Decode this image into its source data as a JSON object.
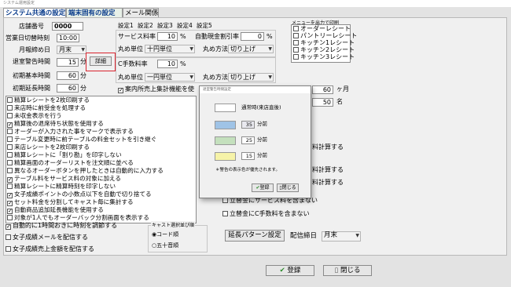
{
  "window": {
    "title": "システム運用設定"
  },
  "tabs": [
    {
      "label": "システム共通の設定",
      "active": true
    },
    {
      "label": "端末固有の設定",
      "active": false
    },
    {
      "label": "メール関係",
      "active": false
    }
  ],
  "left": {
    "store_no_label": "店舗番号",
    "store_no": "0000",
    "cutoff_label": "営業日切替時刻",
    "cutoff": "10:00",
    "closing_label": "月報締め日",
    "closing": "月末",
    "warn_label": "退室警告時間",
    "warn": "15",
    "warn_unit": "分",
    "detail_button": "詳細",
    "base_label": "初期基本時間",
    "base": "60",
    "base_unit": "分",
    "ext_label": "初期延長時間",
    "ext": "60",
    "ext_unit": "分"
  },
  "settings_tabs": [
    "設定1",
    "設定2",
    "設定3",
    "設定4",
    "設定5"
  ],
  "service": {
    "service_label": "サービス料率",
    "service_value": "10",
    "service_unit": "%",
    "auto_discount_label": "自動現金割引率",
    "auto_discount_value": "0",
    "auto_discount_unit": "%",
    "round_unit_label": "丸め単位",
    "round_unit_value": "十円単位",
    "round_method_label": "丸め方法",
    "round_method_value": "切り上げ",
    "c_fee_label": "C手数料率",
    "c_fee_value": "10",
    "c_fee_unit": "%",
    "round_unit2_label": "丸め単位",
    "round_unit2_value": "一円単位",
    "round_method2_label": "丸め方法",
    "round_method2_value": "切り上げ",
    "guide_checkbox": "案内所売上集計機能を使"
  },
  "print_menu": {
    "title": "メニューを出力で印刷",
    "items": [
      "オーダーレシート",
      "パントリーレシート",
      "キッチン1レシート",
      "キッチン2レシート",
      "キッチン3レシート"
    ]
  },
  "right_fields": {
    "months_value": "60",
    "months_unit": "ヶ月",
    "people_value": "50",
    "people_unit": "名"
  },
  "options": [
    {
      "label": "精算レシートを2枚印刷する",
      "checked": false
    },
    {
      "label": "来店時に前受金を処理する",
      "checked": false
    },
    {
      "label": "未収金表示を行う",
      "checked": false
    },
    {
      "label": "精算後の退席待ち状態を使用する",
      "checked": true
    },
    {
      "label": "オーダーが入力された事をマークで表示する",
      "checked": false
    },
    {
      "label": "テーブル変更時に前テーブルの料金セットを引き継ぐ",
      "checked": false
    },
    {
      "label": "来店レシートを2枚印刷する",
      "checked": false
    },
    {
      "label": "精算レシートに「割り勘」を印字しない",
      "checked": false
    },
    {
      "label": "精算画面のオーダーリストを注文順に並べる",
      "checked": false
    },
    {
      "label": "異なるオーダーボタンを押したときは自動的に入力する",
      "checked": false
    },
    {
      "label": "テーブル料をサービス料の対象に加える",
      "checked": true
    },
    {
      "label": "精算レシートに精算時刻を印字しない",
      "checked": false
    },
    {
      "label": "女子成績ポイントの小数点以下を自動で切り捨てる",
      "checked": true
    },
    {
      "label": "セット料金を分割してキャスト毎に集計する",
      "checked": true
    },
    {
      "label": "自動商品追加延長機能を使用する",
      "checked": true
    },
    {
      "label": "対象が1人でもオーダーバック分割画面を表示する",
      "checked": false
    }
  ],
  "bottom_options": [
    {
      "label": "自動的に1時間おきに時刻を調節する",
      "checked": true
    },
    {
      "label": "女子成績メールを配信する",
      "checked": false
    },
    {
      "label": "女子成績売上金額を配信する",
      "checked": false
    }
  ],
  "cast_order": {
    "title": "キャスト選択並び順",
    "options": [
      {
        "label": "コード順",
        "selected": true
      },
      {
        "label": "五十音順",
        "selected": false
      }
    ]
  },
  "right_checks": [
    {
      "label": "立替金にサービス料を含まない",
      "checked": false
    },
    {
      "label": "立替金にC手数料を含まない",
      "checked": false
    }
  ],
  "partial_right": {
    "calc1": "料計算する",
    "calc2": "料計算する",
    "calc3": "料計算する"
  },
  "extension": {
    "button": "延長パターン設定",
    "delivery_label": "配信締日",
    "delivery_value": "月末"
  },
  "footer": {
    "register": "登録",
    "close": "閉じる"
  },
  "dialog": {
    "title": "退室警告時間設定",
    "rows": [
      {
        "color": "#ffffff",
        "text": "通常時(来店直後)",
        "value": "",
        "unit": ""
      },
      {
        "color": "#9fc3e6",
        "text": "",
        "value": "35",
        "unit": "分前"
      },
      {
        "color": "#c4e0bd",
        "text": "",
        "value": "25",
        "unit": "分前"
      },
      {
        "color": "#f6f3a8",
        "text": "",
        "value": "15",
        "unit": "分前"
      }
    ],
    "note": "＊警告の表示色が優先されます。",
    "ok": "登録",
    "close": "閉じる"
  },
  "colors": {
    "highlight": "#d9232e",
    "tab_text": "#0a3c8c"
  }
}
